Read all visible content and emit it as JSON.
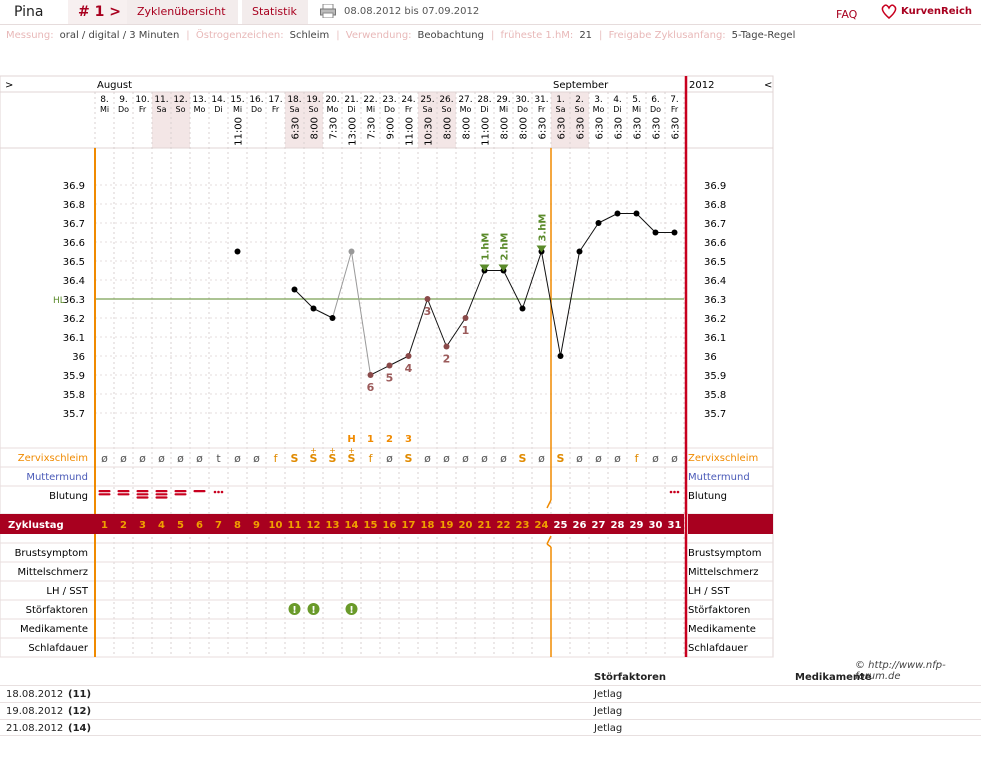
{
  "header": {
    "name": "Pina",
    "cycle_label": "# 1 >",
    "tabs": [
      "Zyklenübersicht",
      "Statistik"
    ],
    "date_range": "08.08.2012 bis 07.09.2012",
    "faq": "FAQ",
    "brand": "KurvenReich"
  },
  "info": [
    {
      "label": "Messung:",
      "value": "oral / digital / 3 Minuten"
    },
    {
      "label": "Östrogenzeichen:",
      "value": "Schleim"
    },
    {
      "label": "Verwendung:",
      "value": "Beobachtung"
    },
    {
      "label": "früheste 1.hM:",
      "value": "21"
    },
    {
      "label": "Freigabe Zyklusanfang:",
      "value": "5-Tage-Regel"
    }
  ],
  "chart_data": {
    "type": "line",
    "months": [
      {
        "label": "August",
        "day": 0
      },
      {
        "label": "September",
        "day": 24
      }
    ],
    "year": "2012",
    "nav": {
      "left": ">",
      "right": "<"
    },
    "dates": [
      "8.",
      "9.",
      "10.",
      "11.",
      "12.",
      "13.",
      "14.",
      "15.",
      "16.",
      "17.",
      "18.",
      "19.",
      "20.",
      "21.",
      "22.",
      "23.",
      "24.",
      "25.",
      "26.",
      "27.",
      "28.",
      "29.",
      "30.",
      "31.",
      "1.",
      "2.",
      "3.",
      "4.",
      "5.",
      "6.",
      "7."
    ],
    "weekdays": [
      "Mi",
      "Do",
      "Fr",
      "Sa",
      "So",
      "Mo",
      "Di",
      "Mi",
      "Do",
      "Fr",
      "Sa",
      "So",
      "Mo",
      "Di",
      "Mi",
      "Do",
      "Fr",
      "Sa",
      "So",
      "Mo",
      "Di",
      "Mi",
      "Do",
      "Fr",
      "Sa",
      "So",
      "Mo",
      "Di",
      "Mi",
      "Do",
      "Fr"
    ],
    "times": [
      "",
      "",
      "",
      "",
      "",
      "",
      "",
      "11:00",
      "",
      "",
      "6:30",
      "8:00",
      "7:30",
      "13:00",
      "7:30",
      "9:00",
      "11:00",
      "10:30",
      "8:00",
      "8:00",
      "11:00",
      "8:00",
      "8:00",
      "6:30",
      "6:30",
      "6:30",
      "6:30",
      "6:30",
      "6:30",
      "6:30",
      "6:30"
    ],
    "cycle_days": [
      1,
      2,
      3,
      4,
      5,
      6,
      7,
      8,
      9,
      10,
      11,
      12,
      13,
      14,
      15,
      16,
      17,
      18,
      19,
      20,
      21,
      22,
      23,
      24,
      25,
      26,
      27,
      28,
      29,
      30,
      31
    ],
    "temperatures": [
      null,
      null,
      null,
      null,
      null,
      null,
      null,
      36.55,
      null,
      null,
      36.35,
      36.25,
      36.2,
      36.55,
      35.9,
      35.95,
      36.0,
      36.3,
      36.05,
      36.2,
      36.45,
      36.45,
      36.25,
      36.55,
      36.0,
      36.55,
      36.7,
      36.75,
      36.75,
      36.65,
      36.65
    ],
    "excluded_days": [
      14
    ],
    "low_count": {
      "18": "3",
      "19": "2",
      "20": "1",
      "15": "6",
      "16": "5",
      "17": "4"
    },
    "yrange": [
      35.6,
      37.0
    ],
    "yticks": [
      "35.7",
      "35.8",
      "35.9",
      "36",
      "36.1",
      "36.2",
      "36.3",
      "36.4",
      "36.5",
      "36.6",
      "36.7",
      "36.8",
      "36.9"
    ],
    "hl": {
      "label": "HL",
      "value": 36.3
    },
    "peaks": [
      {
        "day": 21,
        "label": "1.hM"
      },
      {
        "day": 22,
        "label": "2.hM"
      },
      {
        "day": 24,
        "label": "3.hM"
      }
    ],
    "mucus_peak": {
      "14": "H",
      "15": "1",
      "16": "2",
      "17": "3"
    },
    "mucus": [
      "ø",
      "ø",
      "ø",
      "ø",
      "ø",
      "ø",
      "t",
      "ø",
      "ø",
      "f",
      "S",
      "S",
      "S",
      "S",
      "f",
      "ø",
      "S",
      "ø",
      "ø",
      "ø",
      "ø",
      "ø",
      "S",
      "ø",
      "S",
      "ø",
      "ø",
      "ø",
      "f",
      "ø",
      "ø"
    ],
    "mucus_plus": [
      12,
      13,
      14
    ],
    "bleeding": [
      2,
      2,
      3,
      3,
      2,
      1,
      "s",
      0,
      0,
      0,
      0,
      0,
      0,
      0,
      0,
      0,
      0,
      0,
      0,
      0,
      0,
      0,
      0,
      0,
      0,
      0,
      0,
      0,
      0,
      0,
      "s"
    ],
    "stoerfaktor_days": [
      11,
      12,
      14
    ],
    "row_labels": {
      "zervix": "Zervixschleim",
      "muttermund": "Muttermund",
      "blutung": "Blutung",
      "zyklustag": "Zyklustag",
      "bottom": [
        "Brustsymptom",
        "Mittelschmerz",
        "LH / SST",
        "Störfaktoren",
        "Medikamente",
        "Schlafdauer"
      ]
    },
    "colors": {
      "accent": "#a8001f",
      "orange": "#f08a00",
      "green": "#5a8a2a",
      "line": "#111111",
      "mucus": "#e08a00",
      "count": "#9b5a5a"
    }
  },
  "footer": {
    "copyright": "© http://www.nfp-forum.de",
    "columns": [
      "Störfaktoren",
      "Medikamente"
    ],
    "rows": [
      {
        "date": "18.08.2012",
        "day": "(11)",
        "factor": "Jetlag"
      },
      {
        "date": "19.08.2012",
        "day": "(12)",
        "factor": "Jetlag"
      },
      {
        "date": "21.08.2012",
        "day": "(14)",
        "factor": "Jetlag"
      }
    ]
  }
}
